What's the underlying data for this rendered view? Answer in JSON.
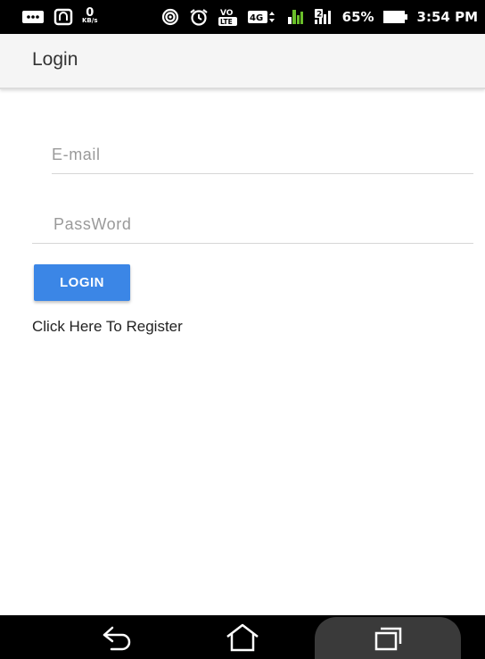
{
  "status_bar": {
    "icons": [
      "message-icon",
      "nfc-icon",
      "hotspot-icon",
      "alarm-icon",
      "volte-icon",
      "4g-icon",
      "signal-icon",
      "signal-2-icon",
      "battery-icon"
    ],
    "data_speed_value": "0",
    "data_speed_unit": "KB/s",
    "volte_label": "VO",
    "lte_label": "LTE",
    "net_type": "4G",
    "sim2_label": "2",
    "battery": "65%",
    "time": "3:54 PM"
  },
  "app_bar": {
    "title": "Login"
  },
  "form": {
    "email_placeholder": "E-mail",
    "password_placeholder": "PassWord",
    "login_label": "LOGIN",
    "register_link": "Click Here To Register"
  },
  "nav_bar": {
    "icons": [
      "back-icon",
      "home-icon",
      "recent-apps-icon"
    ]
  },
  "colors": {
    "accent": "#3b86e6",
    "status_bar": "#000000",
    "app_bar": "#f5f5f5"
  }
}
